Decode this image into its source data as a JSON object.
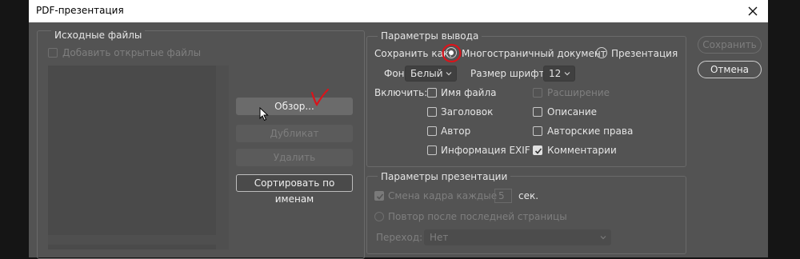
{
  "window": {
    "title": "PDF-презентация",
    "close_icon": "close-icon"
  },
  "source": {
    "legend": "Исходные файлы",
    "add_open_label": "Добавить открытые файлы",
    "browse_label": "Обзор...",
    "duplicate_label": "Дубликат",
    "delete_label": "Удалить",
    "sort_label": "Сортировать по именам"
  },
  "output": {
    "legend": "Параметры вывода",
    "save_as_label": "Сохранить как:",
    "multipage_label": "Многостраничный документ",
    "presentation_label": "Презентация",
    "save_as_selected": "multipage",
    "bg_label": "Фон:",
    "bg_value": "Белый",
    "font_size_label": "Размер шрифта:",
    "font_size_value": "12",
    "include_label": "Включить:",
    "checkboxes": {
      "filename": {
        "label": "Имя файла",
        "checked": false,
        "enabled": true
      },
      "extension": {
        "label": "Расширение",
        "checked": false,
        "enabled": false
      },
      "title": {
        "label": "Заголовок",
        "checked": false,
        "enabled": true
      },
      "description": {
        "label": "Описание",
        "checked": false,
        "enabled": true
      },
      "author": {
        "label": "Автор",
        "checked": false,
        "enabled": true
      },
      "copyright": {
        "label": "Авторские права",
        "checked": false,
        "enabled": true
      },
      "exif": {
        "label": "Информация EXIF",
        "checked": false,
        "enabled": true
      },
      "comments": {
        "label": "Комментарии",
        "checked": true,
        "enabled": true
      }
    }
  },
  "presentation": {
    "legend": "Параметры презентации",
    "advance_label": "Смена кадра каждые",
    "advance_value": "5",
    "seconds_label": "сек.",
    "loop_label": "Повтор после последней страницы",
    "transition_label": "Переход:",
    "transition_value": "Нет"
  },
  "actions": {
    "save_label": "Сохранить",
    "cancel_label": "Отмена"
  },
  "colors": {
    "dialog_bg": "#535353",
    "annotation_red": "#d9141b"
  }
}
